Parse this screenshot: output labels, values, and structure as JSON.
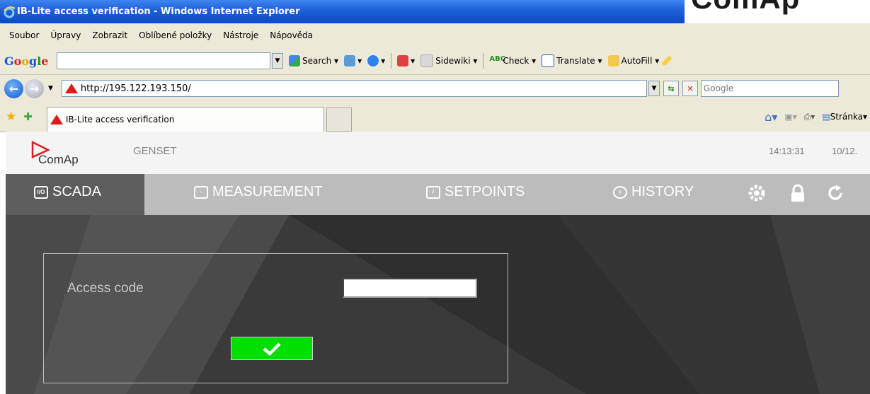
{
  "window": {
    "title": "IB-Lite access verification - Windows Internet Explorer",
    "watermark": "ComAp"
  },
  "menubar": [
    "Soubor",
    "Úpravy",
    "Zobrazit",
    "Oblíbené položky",
    "Nástroje",
    "Nápověda"
  ],
  "googlebar": {
    "search_label": "Search",
    "sidewiki": "Sidewiki",
    "check": "Check",
    "translate": "Translate",
    "autofill": "AutoFill"
  },
  "addressbar": {
    "url": "http://195.122.193.150/",
    "search_placeholder": "Google"
  },
  "favorites": {
    "tab_title": "IB-Lite access verification",
    "page_menu": "Stránka"
  },
  "header": {
    "logo_text": "ComAp",
    "device": "GENSET",
    "time": "14:13:31",
    "date": "10/12."
  },
  "nav": {
    "scada": "SCADA",
    "measurement": "MEASUREMENT",
    "setpoints": "SETPOINTS",
    "history": "HISTORY"
  },
  "form": {
    "access_label": "Access code",
    "access_value": ""
  },
  "colors": {
    "accent_red": "#e01a1a",
    "submit_green": "#00e000",
    "active_tab": "#5d5d5d"
  }
}
